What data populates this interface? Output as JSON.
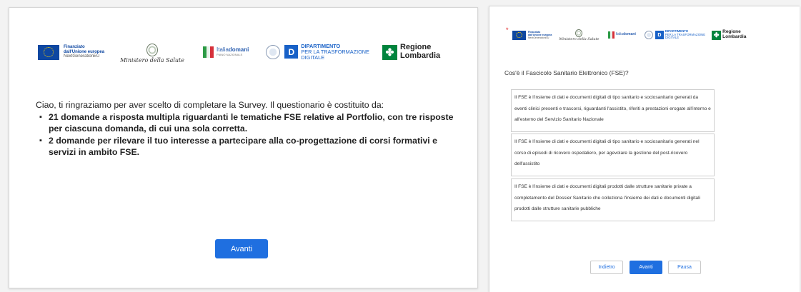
{
  "logos": {
    "eu": {
      "title": "Finanziato",
      "line2": "dall'Unione europea",
      "line3": "NextGenerationEU"
    },
    "ministero": "Ministero della Salute",
    "italiadomani": {
      "name_a": "Italia",
      "name_b": "domani",
      "sub": "PIANO NAZIONALE"
    },
    "dipartimento": {
      "title": "DIPARTIMENTO",
      "line2": "PER LA TRASFORMAZIONE",
      "line3": "DIGITALE",
      "mark": "D"
    },
    "lombardia": {
      "line1": "Regione",
      "line2": "Lombardia"
    }
  },
  "intro": {
    "text": "Ciao, ti ringraziamo per aver scelto di completare la Survey. Il questionario è costituito da:",
    "items": [
      "21 domande a risposta multipla riguardanti le tematiche FSE relative al Portfolio, con tre risposte per ciascuna domanda, di cui una sola corretta.",
      "2 domande per rilevare il tuo interesse a partecipare alla co-progettazione di corsi formativi e servizi in ambito FSE."
    ],
    "button": "Avanti"
  },
  "question": {
    "title": "Cos'è il Fascicolo Sanitario Elettronico (FSE)?",
    "options": [
      "Il FSE è l'insieme di dati e documenti digitali di tipo sanitario e sociosanitario generati da eventi clinici presenti e trascorsi, riguardanti l'assistito, riferiti a prestazioni erogate all'interno e all'esterno del Servizio Sanitario Nazionale",
      "Il FSE è l'insieme di dati e documenti digitali di tipo sanitario e sociosanitario generati nel corso di episodi di ricovero ospedaliero, per agevolare la gestione del post-ricovero dell'assistito",
      "Il FSE è l'insieme di dati e documenti digitali prodotti dalle strutture sanitarie private a completamento del Dossier Sanitario che colleziona l'insieme dei dati e documenti digitali prodotti dalle strutture sanitarie pubbliche"
    ],
    "buttons": {
      "back": "Indietro",
      "next": "Avanti",
      "pause": "Pausa"
    }
  },
  "colors": {
    "primary": "#1f6fe0",
    "eu_blue": "#0e47a1",
    "lombardia_green": "#00843d"
  }
}
